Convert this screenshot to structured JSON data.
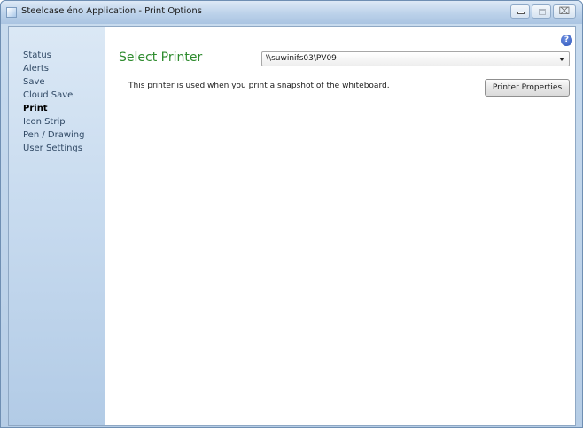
{
  "window": {
    "title": "Steelcase éno Application - Print Options",
    "minimize_icon": "minimize-icon",
    "maximize_icon": "maximize-icon",
    "close_icon": "close-icon",
    "close_glyph": "⌧"
  },
  "sidebar": {
    "items": [
      {
        "label": "Status",
        "active": false
      },
      {
        "label": "Alerts",
        "active": false
      },
      {
        "label": "Save",
        "active": false
      },
      {
        "label": "Cloud Save",
        "active": false
      },
      {
        "label": "Print",
        "active": true
      },
      {
        "label": "Icon Strip",
        "active": false
      },
      {
        "label": "Pen / Drawing",
        "active": false
      },
      {
        "label": "User Settings",
        "active": false
      }
    ]
  },
  "main": {
    "help_icon": "help-icon",
    "help_glyph": "?",
    "select_printer_label": "Select Printer",
    "printer": {
      "selected_value": "\\\\suwinifs03\\PV09",
      "arrow_icon": "dropdown-arrow-icon"
    },
    "description": "This printer is used when you print a snapshot of the whiteboard.",
    "printer_properties_button": "Printer Properties"
  },
  "colors": {
    "heading_green": "#2e8b2e",
    "sidebar_blue": "#c8dbef",
    "help_blue": "#2c54b8"
  }
}
